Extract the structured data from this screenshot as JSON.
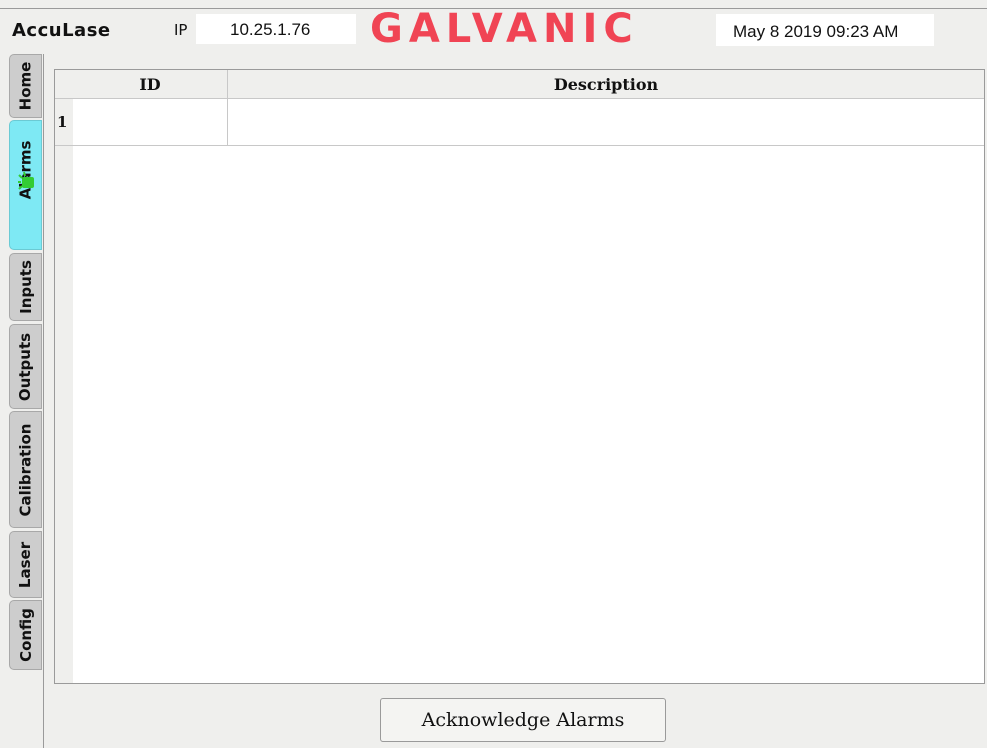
{
  "header": {
    "app_name": "AccuLase",
    "ip_label": "IP",
    "ip_value": "10.25.1.76",
    "brand": "GALVANIC",
    "brand_color": "#f04454",
    "datetime": "May 8 2019 09:23 AM"
  },
  "tabs": [
    {
      "label": "Home",
      "active": false
    },
    {
      "label": "Alarms",
      "active": true,
      "icon": "alarm-indicator-icon",
      "icon_color": "#33cc33"
    },
    {
      "label": "Inputs",
      "active": false
    },
    {
      "label": "Outputs",
      "active": false
    },
    {
      "label": "Calibration",
      "active": false
    },
    {
      "label": "Laser",
      "active": false
    },
    {
      "label": "Config",
      "active": false
    }
  ],
  "active_tab_color": "#7ee9f4",
  "alarms_table": {
    "columns": [
      "ID",
      "Description"
    ],
    "rows": [
      {
        "row_number": "1",
        "id": "",
        "description": ""
      }
    ]
  },
  "actions": {
    "acknowledge_label": "Acknowledge Alarms"
  }
}
